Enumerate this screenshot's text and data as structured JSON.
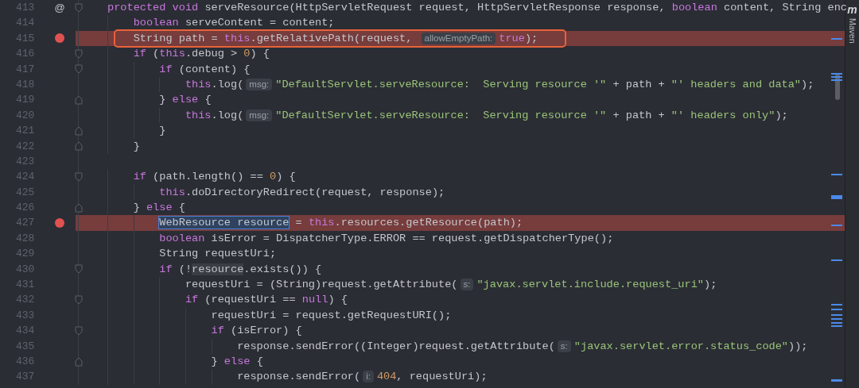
{
  "editor": {
    "lines": [
      {
        "number": "413",
        "breakpoint": false,
        "gutter_mark": "@",
        "fold_start": true,
        "fold_end": false,
        "tokens": [
          {
            "kind": "kw",
            "text": "protected void"
          },
          {
            "kind": "plain",
            "text": " serveResource(HttpServletRequest request, HttpServletResponse response, "
          },
          {
            "kind": "kw",
            "text": "boolean"
          },
          {
            "kind": "plain",
            "text": " content, String enc"
          }
        ]
      },
      {
        "number": "414",
        "breakpoint": false,
        "fold_start": false,
        "fold_end": false,
        "tokens": [
          {
            "kind": "kw",
            "text": "boolean"
          },
          {
            "kind": "plain",
            "text": " serveContent = content;"
          }
        ]
      },
      {
        "number": "415",
        "breakpoint": true,
        "framed": true,
        "fold_start": false,
        "fold_end": false,
        "tokens": [
          {
            "kind": "plain",
            "text": "String path = "
          },
          {
            "kind": "kw",
            "text": "this"
          },
          {
            "kind": "plain",
            "text": ".getRelativePath(request, "
          },
          {
            "kind": "hint",
            "text": "allowEmptyPath:"
          },
          {
            "kind": "kw",
            "text": "true"
          },
          {
            "kind": "plain",
            "text": ");"
          }
        ]
      },
      {
        "number": "416",
        "breakpoint": false,
        "fold_start": true,
        "fold_end": false,
        "tokens": [
          {
            "kind": "kw",
            "text": "if"
          },
          {
            "kind": "plain",
            "text": " ("
          },
          {
            "kind": "kw",
            "text": "this"
          },
          {
            "kind": "plain",
            "text": ".debug > "
          },
          {
            "kind": "num",
            "text": "0"
          },
          {
            "kind": "plain",
            "text": ") {"
          }
        ]
      },
      {
        "number": "417",
        "breakpoint": false,
        "fold_start": true,
        "fold_end": false,
        "tokens": [
          {
            "kind": "kw",
            "text": "if"
          },
          {
            "kind": "plain",
            "text": " (content) {"
          }
        ]
      },
      {
        "number": "418",
        "breakpoint": false,
        "fold_start": false,
        "fold_end": false,
        "tokens": [
          {
            "kind": "kw",
            "text": "this"
          },
          {
            "kind": "plain",
            "text": ".log("
          },
          {
            "kind": "hint",
            "text": "msg:"
          },
          {
            "kind": "str",
            "text": "\"DefaultServlet.serveResource:  Serving resource '\""
          },
          {
            "kind": "plain",
            "text": " + path + "
          },
          {
            "kind": "str",
            "text": "\"' headers and data\""
          },
          {
            "kind": "plain",
            "text": ");"
          }
        ]
      },
      {
        "number": "419",
        "breakpoint": false,
        "fold_start": true,
        "fold_end": true,
        "tokens": [
          {
            "kind": "plain",
            "text": "} "
          },
          {
            "kind": "kw",
            "text": "else"
          },
          {
            "kind": "plain",
            "text": " {"
          }
        ]
      },
      {
        "number": "420",
        "breakpoint": false,
        "fold_start": false,
        "fold_end": false,
        "tokens": [
          {
            "kind": "kw",
            "text": "this"
          },
          {
            "kind": "plain",
            "text": ".log("
          },
          {
            "kind": "hint",
            "text": "msg:"
          },
          {
            "kind": "str",
            "text": "\"DefaultServlet.serveResource:  Serving resource '\""
          },
          {
            "kind": "plain",
            "text": " + path + "
          },
          {
            "kind": "str",
            "text": "\"' headers only\""
          },
          {
            "kind": "plain",
            "text": ");"
          }
        ]
      },
      {
        "number": "421",
        "breakpoint": false,
        "fold_start": false,
        "fold_end": true,
        "tokens": [
          {
            "kind": "plain",
            "text": "}"
          }
        ]
      },
      {
        "number": "422",
        "breakpoint": false,
        "fold_start": false,
        "fold_end": true,
        "tokens": [
          {
            "kind": "plain",
            "text": "}"
          }
        ]
      },
      {
        "number": "423",
        "breakpoint": false,
        "fold_start": false,
        "fold_end": false
      },
      {
        "number": "424",
        "breakpoint": false,
        "fold_start": true,
        "fold_end": false,
        "tokens": [
          {
            "kind": "kw",
            "text": "if"
          },
          {
            "kind": "plain",
            "text": " (path.length() == "
          },
          {
            "kind": "num",
            "text": "0"
          },
          {
            "kind": "plain",
            "text": ") {"
          }
        ]
      },
      {
        "number": "425",
        "breakpoint": false,
        "fold_start": false,
        "fold_end": false,
        "tokens": [
          {
            "kind": "kw",
            "text": "this"
          },
          {
            "kind": "plain",
            "text": ".doDirectoryRedirect(request, response);"
          }
        ]
      },
      {
        "number": "426",
        "breakpoint": false,
        "fold_start": true,
        "fold_end": true,
        "tokens": [
          {
            "kind": "plain",
            "text": "} "
          },
          {
            "kind": "kw",
            "text": "else"
          },
          {
            "kind": "plain",
            "text": " {"
          }
        ]
      },
      {
        "number": "427",
        "breakpoint": true,
        "fold_start": false,
        "fold_end": false,
        "tokens": [
          {
            "kind": "sel",
            "text": "WebResource resource"
          },
          {
            "kind": "plain",
            "text": " = "
          },
          {
            "kind": "kw",
            "text": "this"
          },
          {
            "kind": "plain",
            "text": ".resources.getResource(path);"
          }
        ]
      },
      {
        "number": "428",
        "breakpoint": false,
        "fold_start": false,
        "fold_end": false,
        "tokens": [
          {
            "kind": "kw",
            "text": "boolean"
          },
          {
            "kind": "plain",
            "text": " isError = DispatcherType.ERROR == request.getDispatcherType();"
          }
        ]
      },
      {
        "number": "429",
        "breakpoint": false,
        "fold_start": false,
        "fold_end": false,
        "tokens": [
          {
            "kind": "plain",
            "text": "String requestUri;"
          }
        ]
      },
      {
        "number": "430",
        "breakpoint": false,
        "fold_start": true,
        "fold_end": false,
        "tokens": [
          {
            "kind": "kw",
            "text": "if"
          },
          {
            "kind": "plain",
            "text": " (!"
          },
          {
            "kind": "usage",
            "text": "resource"
          },
          {
            "kind": "plain",
            "text": ".exists()) {"
          }
        ]
      },
      {
        "number": "431",
        "breakpoint": false,
        "fold_start": false,
        "fold_end": false,
        "tokens": [
          {
            "kind": "plain",
            "text": "requestUri = (String)request.getAttribute("
          },
          {
            "kind": "hint",
            "text": "s:"
          },
          {
            "kind": "str",
            "text": "\"javax.servlet.include.request_uri\""
          },
          {
            "kind": "plain",
            "text": ");"
          }
        ]
      },
      {
        "number": "432",
        "breakpoint": false,
        "fold_start": true,
        "fold_end": false,
        "tokens": [
          {
            "kind": "kw",
            "text": "if"
          },
          {
            "kind": "plain",
            "text": " (requestUri == "
          },
          {
            "kind": "kw",
            "text": "null"
          },
          {
            "kind": "plain",
            "text": ") {"
          }
        ]
      },
      {
        "number": "433",
        "breakpoint": false,
        "fold_start": false,
        "fold_end": false,
        "tokens": [
          {
            "kind": "plain",
            "text": "requestUri = request.getRequestURI();"
          }
        ]
      },
      {
        "number": "434",
        "breakpoint": false,
        "fold_start": true,
        "fold_end": false,
        "tokens": [
          {
            "kind": "kw",
            "text": "if"
          },
          {
            "kind": "plain",
            "text": " (isError) {"
          }
        ]
      },
      {
        "number": "435",
        "breakpoint": false,
        "fold_start": false,
        "fold_end": false,
        "tokens": [
          {
            "kind": "plain",
            "text": "response.sendError((Integer)request.getAttribute("
          },
          {
            "kind": "hint",
            "text": "s:"
          },
          {
            "kind": "str",
            "text": "\"javax.servlet.error.status_code\""
          },
          {
            "kind": "plain",
            "text": "));"
          }
        ]
      },
      {
        "number": "436",
        "breakpoint": false,
        "fold_start": true,
        "fold_end": true,
        "tokens": [
          {
            "kind": "plain",
            "text": "} "
          },
          {
            "kind": "kw",
            "text": "else"
          },
          {
            "kind": "plain",
            "text": " {"
          }
        ]
      },
      {
        "number": "437",
        "breakpoint": false,
        "fold_start": false,
        "fold_end": false,
        "tokens": [
          {
            "kind": "plain",
            "text": "response.sendError("
          },
          {
            "kind": "hint",
            "text": "i:"
          },
          {
            "kind": "num",
            "text": "404"
          },
          {
            "kind": "plain",
            "text": ", requestUri);"
          }
        ]
      }
    ]
  },
  "side_panel": {
    "icon_letter": "m",
    "label": "Maven"
  }
}
